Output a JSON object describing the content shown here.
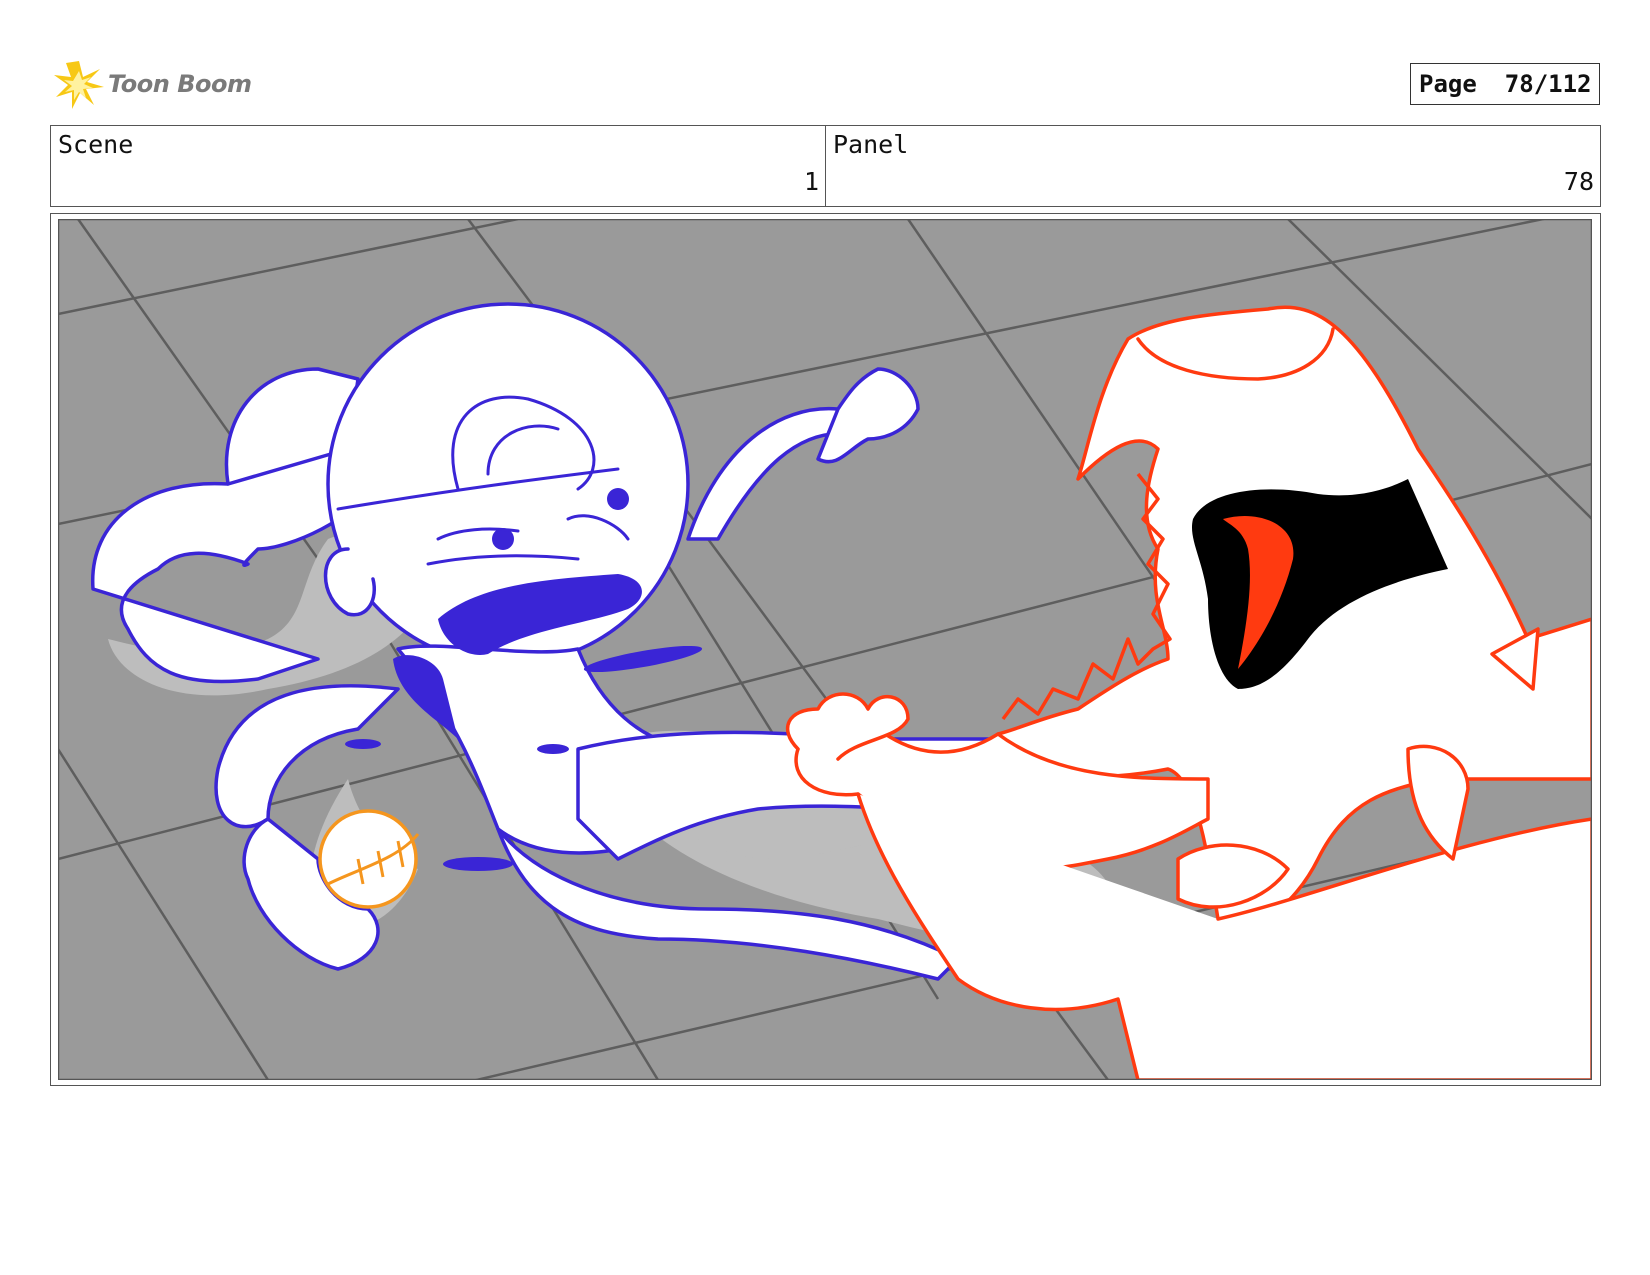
{
  "header": {
    "logo_text": "Toon Boom",
    "page_label": "Page",
    "page_value": "78/112"
  },
  "info": {
    "scene_label": "Scene",
    "scene_value": "1",
    "panel_label": "Panel",
    "panel_value": "78"
  },
  "colors": {
    "floor": "#9a9a9a",
    "floor_lines": "#5e5e5e",
    "shadow": "#bdbdbd",
    "character_blue": "#3a25d6",
    "creature_red": "#ff3a10",
    "ball_orange": "#f5961e",
    "logo_yellow": "#f7c815"
  }
}
